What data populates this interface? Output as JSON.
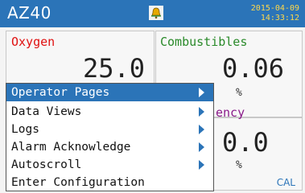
{
  "header": {
    "device_name": "AZ40",
    "date": "2015-04-09",
    "time": "14:33:12",
    "alarm_icon": "bell-alarm-icon"
  },
  "panels": {
    "oxygen": {
      "label": "Oxygen",
      "value": "25.0",
      "color": "#e01010"
    },
    "combustibles": {
      "label": "Combustibles",
      "value": "0.06",
      "unit": "%",
      "color": "#2a8a2a"
    },
    "efficiency": {
      "label_fragment": "ency",
      "value": "0.0",
      "unit": "%",
      "color": "#8a1a8a"
    }
  },
  "status": {
    "cal": "CAL"
  },
  "menu": {
    "items": [
      {
        "label": "Operator Pages",
        "submenu": true,
        "selected": true
      },
      {
        "label": "Data Views",
        "submenu": true,
        "selected": false
      },
      {
        "label": "Logs",
        "submenu": true,
        "selected": false
      },
      {
        "label": "Alarm Acknowledge",
        "submenu": true,
        "selected": false
      },
      {
        "label": "Autoscroll",
        "submenu": true,
        "selected": false
      },
      {
        "label": "Enter Configuration",
        "submenu": false,
        "selected": false
      }
    ]
  },
  "colors": {
    "accent": "#2b74b8",
    "clock": "#ffd84a"
  }
}
